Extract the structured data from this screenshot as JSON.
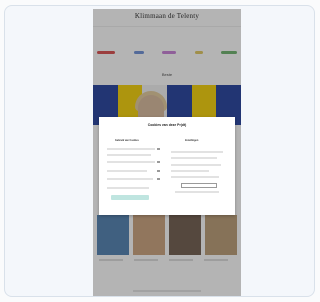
{
  "masthead": {
    "title": "Klimmaan de Telenty"
  },
  "nav": {
    "items": [
      "",
      "",
      "",
      "",
      "",
      "",
      ""
    ]
  },
  "pills": {
    "colors": [
      "#d94a4a",
      "#6b8ed6",
      "#c77dd6",
      "#e0c65c",
      "#6bb16b"
    ]
  },
  "section": {
    "label": "Beste"
  },
  "hero": {
    "colors": [
      "#1f3d9c",
      "#f5d000",
      "#f2f2f2",
      "#1f3d9c",
      "#f5d000",
      "#1f3d9c"
    ]
  },
  "modal": {
    "title": "Cookies van deze Pr(dt)",
    "left_heading": "Gebruik van Cookies",
    "right_heading": "Instellingen"
  },
  "thumbs": {
    "colors": [
      "#4e7fb0",
      "#c9a07a",
      "#6e5a4a",
      "#b89a72"
    ]
  },
  "colors": {
    "page_bg": "#fafbfc",
    "card_bg": "#f4f7fb",
    "card_border": "#d9e1ea",
    "accept_button": "#bfe5e0"
  }
}
